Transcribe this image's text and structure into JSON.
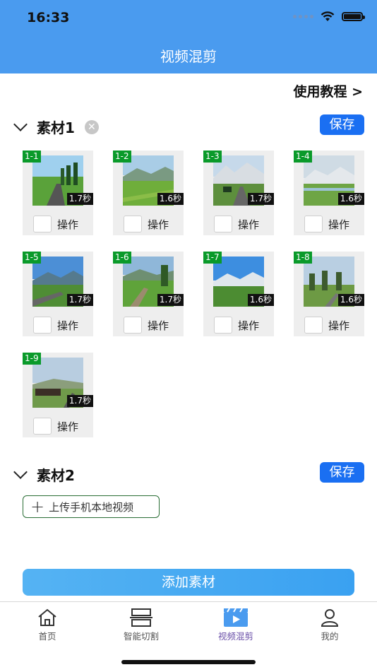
{
  "status": {
    "time": "16:33"
  },
  "nav": {
    "title": "视频混剪"
  },
  "tutorial": {
    "label": "使用教程 >"
  },
  "sections": [
    {
      "title": "素材1",
      "save_label": "保存",
      "clear_glyph": "✕",
      "clips": [
        {
          "index": "1-1",
          "duration": "1.7秒",
          "op": "操作"
        },
        {
          "index": "1-2",
          "duration": "1.6秒",
          "op": "操作"
        },
        {
          "index": "1-3",
          "duration": "1.7秒",
          "op": "操作"
        },
        {
          "index": "1-4",
          "duration": "1.6秒",
          "op": "操作"
        },
        {
          "index": "1-5",
          "duration": "1.7秒",
          "op": "操作"
        },
        {
          "index": "1-6",
          "duration": "1.7秒",
          "op": "操作"
        },
        {
          "index": "1-7",
          "duration": "1.6秒",
          "op": "操作"
        },
        {
          "index": "1-8",
          "duration": "1.6秒",
          "op": "操作"
        },
        {
          "index": "1-9",
          "duration": "1.7秒",
          "op": "操作"
        }
      ]
    },
    {
      "title": "素材2",
      "save_label": "保存",
      "upload_label": "上传手机本地视频"
    }
  ],
  "add_button": {
    "label": "添加素材"
  },
  "tabs": [
    {
      "label": "首页",
      "icon": "home-icon",
      "active": false
    },
    {
      "label": "智能切割",
      "icon": "cut-icon",
      "active": false
    },
    {
      "label": "视频混剪",
      "icon": "video-mix-icon",
      "active": true
    },
    {
      "label": "我的",
      "icon": "profile-icon",
      "active": false
    }
  ],
  "colors": {
    "header": "#4a9bef",
    "save": "#1a6ff2",
    "index_badge": "#0a9a2a",
    "tab_active": "#6a4fa8"
  }
}
